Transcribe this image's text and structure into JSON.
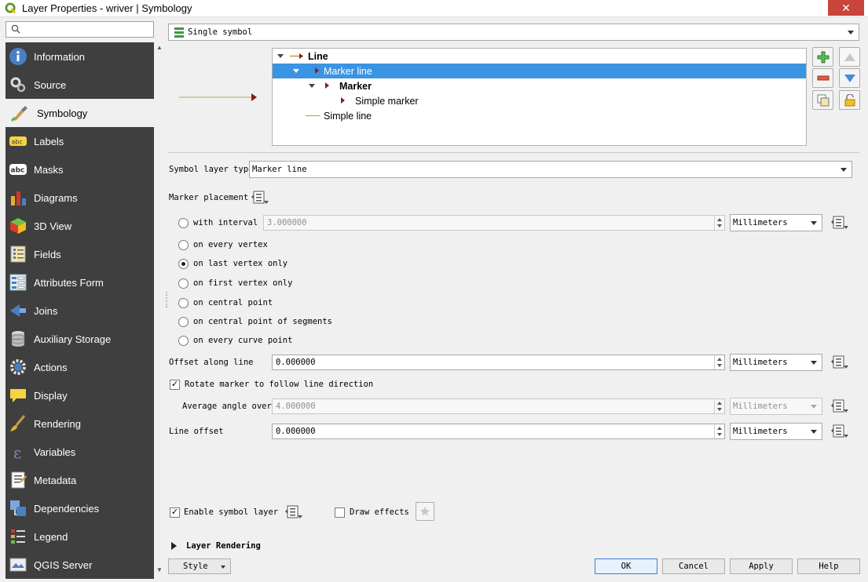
{
  "window": {
    "title": "Layer Properties - wriver | Symbology",
    "close_glyph": "✕"
  },
  "sidebar": {
    "search_placeholder": "",
    "items": [
      {
        "label": "Information",
        "icon": "info-icon",
        "active": false
      },
      {
        "label": "Source",
        "icon": "source-icon",
        "active": false
      },
      {
        "label": "Symbology",
        "icon": "paintbrush-icon",
        "active": true
      },
      {
        "label": "Labels",
        "icon": "labels-icon",
        "active": false
      },
      {
        "label": "Masks",
        "icon": "masks-icon",
        "active": false
      },
      {
        "label": "Diagrams",
        "icon": "diagrams-icon",
        "active": false
      },
      {
        "label": "3D View",
        "icon": "cube-icon",
        "active": false
      },
      {
        "label": "Fields",
        "icon": "fields-icon",
        "active": false
      },
      {
        "label": "Attributes Form",
        "icon": "form-icon",
        "active": false
      },
      {
        "label": "Joins",
        "icon": "joins-icon",
        "active": false
      },
      {
        "label": "Auxiliary Storage",
        "icon": "database-icon",
        "active": false
      },
      {
        "label": "Actions",
        "icon": "gear-icon",
        "active": false
      },
      {
        "label": "Display",
        "icon": "speech-bubble-icon",
        "active": false
      },
      {
        "label": "Rendering",
        "icon": "brush-icon",
        "active": false
      },
      {
        "label": "Variables",
        "icon": "epsilon-icon",
        "active": false
      },
      {
        "label": "Metadata",
        "icon": "metadata-icon",
        "active": false
      },
      {
        "label": "Dependencies",
        "icon": "dependencies-icon",
        "active": false
      },
      {
        "label": "Legend",
        "icon": "legend-icon",
        "active": false
      },
      {
        "label": "QGIS Server",
        "icon": "server-icon",
        "active": false
      }
    ]
  },
  "renderer": {
    "type": "Single symbol"
  },
  "symbol_tree": [
    {
      "label": "Line",
      "bold": true,
      "selected": false
    },
    {
      "label": "Marker line",
      "bold": false,
      "selected": true
    },
    {
      "label": "Marker",
      "bold": true,
      "selected": false
    },
    {
      "label": "Simple marker",
      "bold": false,
      "selected": false
    },
    {
      "label": "Simple line",
      "bold": false,
      "selected": false
    }
  ],
  "symbol_layer_type": {
    "label": "Symbol layer type",
    "value": "Marker line"
  },
  "marker_placement": {
    "label": "Marker placement",
    "interval": {
      "label": "with interval",
      "value": "3.000000",
      "unit": "Millimeters"
    },
    "options": [
      {
        "label": "on every vertex",
        "checked": false
      },
      {
        "label": "on last vertex only",
        "checked": true
      },
      {
        "label": "on first vertex only",
        "checked": false
      },
      {
        "label": "on central point",
        "checked": false
      },
      {
        "label": "on central point of segments",
        "checked": false
      },
      {
        "label": "on every curve point",
        "checked": false
      }
    ]
  },
  "offset_along_line": {
    "label": "Offset along line",
    "value": "0.000000",
    "unit": "Millimeters"
  },
  "rotate_marker": {
    "label": "Rotate marker to follow line direction",
    "checked": true
  },
  "average_angle": {
    "label": "Average angle over",
    "value": "4.000000",
    "unit": "Millimeters"
  },
  "line_offset": {
    "label": "Line offset",
    "value": "0.000000",
    "unit": "Millimeters"
  },
  "enable_symbol_layer": {
    "label": "Enable symbol layer",
    "checked": true
  },
  "draw_effects": {
    "label": "Draw effects",
    "checked": false
  },
  "layer_rendering": {
    "label": "Layer Rendering"
  },
  "footer": {
    "style": "Style",
    "ok": "OK",
    "cancel": "Cancel",
    "apply": "Apply",
    "help": "Help"
  },
  "check_glyph": "✓"
}
